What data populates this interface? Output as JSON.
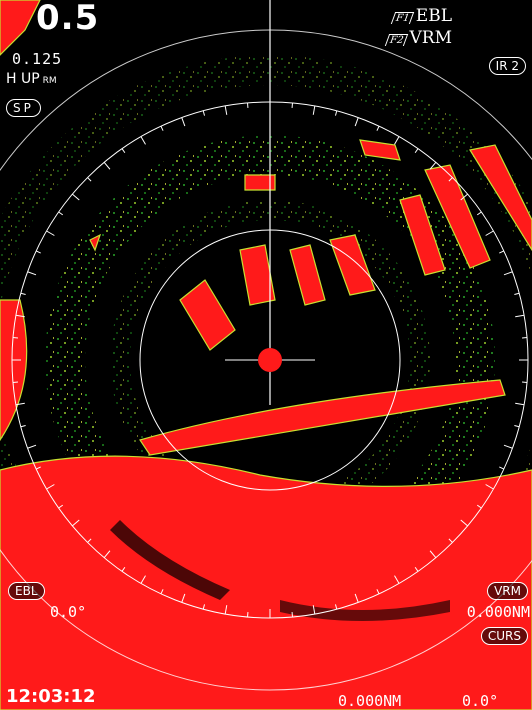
{
  "display": {
    "range": "0.5",
    "ring_interval": "0.125",
    "orientation": "H UP",
    "motion": "RM",
    "sp_button": "SP",
    "ir_button": "IR 2",
    "f1_key": "F1",
    "f1_label": "EBL",
    "f2_key": "F2",
    "f2_label": "VRM",
    "ebl_button": "EBL",
    "ebl_value": "0.0°",
    "vrm_button": "VRM",
    "vrm_value": "0.000NM",
    "curs_button": "CURS",
    "cursor_range": "0.000NM",
    "cursor_bearing": "0.0°",
    "clock": "12:03:12"
  },
  "colors": {
    "echo": "#ff1a1a",
    "echo_edge": "#c8e030",
    "clutter": "#1e8a1e",
    "rings": "#ffffff",
    "background": "#000000"
  }
}
